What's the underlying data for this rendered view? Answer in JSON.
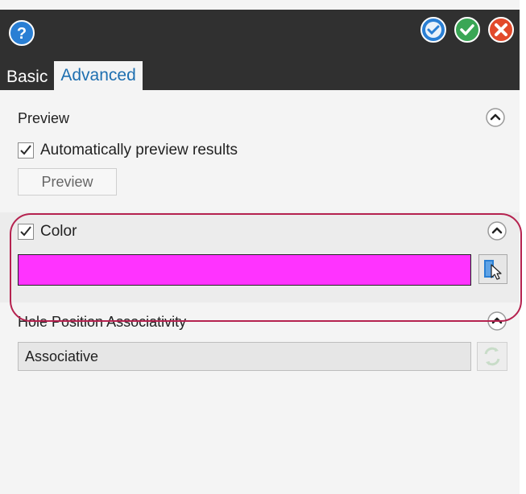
{
  "tabs": {
    "basic": "Basic",
    "advanced": "Advanced"
  },
  "preview_section": {
    "title": "Preview",
    "auto_preview_label": "Automatically preview results",
    "auto_preview_checked": true,
    "preview_button": "Preview"
  },
  "color_section": {
    "label": "Color",
    "checked": true,
    "swatch_color": "#ff33ff"
  },
  "hole_section": {
    "title": "Hole Position Associativity",
    "value": "Associative"
  },
  "colors": {
    "titlebar": "#303030",
    "accent_tab": "#1e6fb0",
    "highlight": "#b5224f",
    "ok": "#3aa655",
    "cancel": "#e24a2b",
    "apply": "#2a7fd4"
  },
  "icons": {
    "help": "help-icon",
    "apply": "apply-icon",
    "ok": "ok-check-icon",
    "cancel": "cancel-x-icon",
    "collapse": "chevron-up-icon",
    "picker": "color-picker-icon",
    "refresh": "refresh-icon"
  }
}
